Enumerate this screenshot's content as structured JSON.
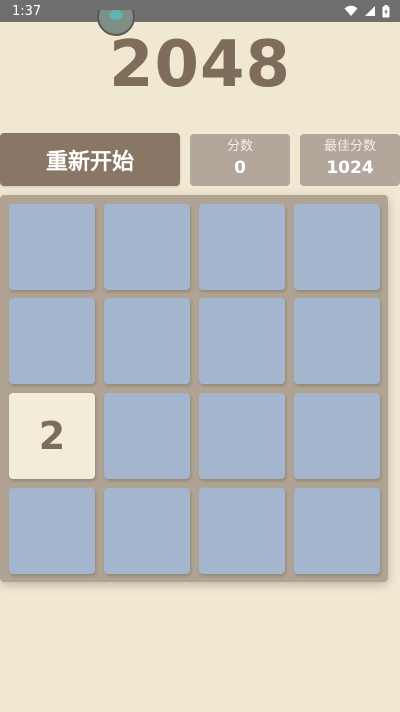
{
  "status_bar": {
    "time": "1:37"
  },
  "game": {
    "title": "2048",
    "restart_label": "重新开始",
    "score_label": "分数",
    "score_value": "0",
    "best_label": "最佳分数",
    "best_value": "1024"
  },
  "board": {
    "rows": [
      [
        "",
        "",
        "",
        ""
      ],
      [
        "",
        "",
        "",
        ""
      ],
      [
        "2",
        "",
        "",
        ""
      ],
      [
        "",
        "",
        "",
        ""
      ]
    ]
  },
  "colors": {
    "background": "#f1e8d2",
    "title": "#7f6d5b",
    "restart_button": "#8a7664",
    "score_box": "#b3a79b",
    "board": "#b0a393",
    "empty_tile": "#a4b6ce",
    "tile_2": "#f3ecd9"
  }
}
